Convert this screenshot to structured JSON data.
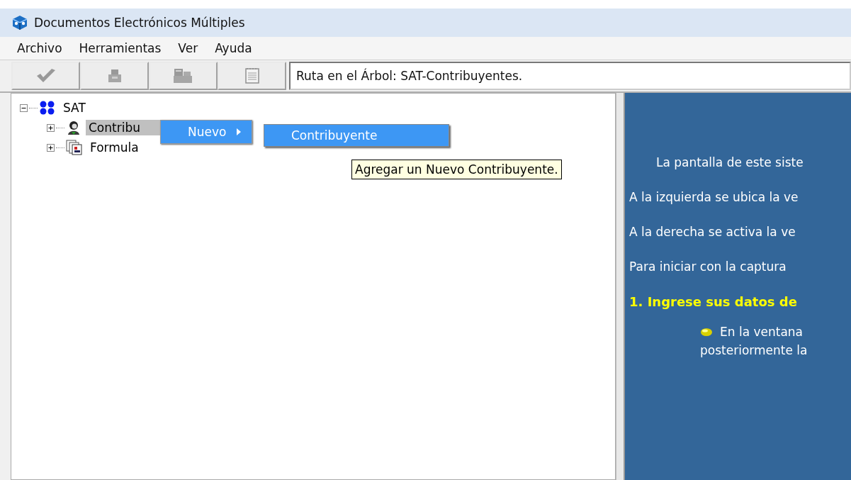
{
  "window": {
    "title": "Documentos Electrónicos Múltiples"
  },
  "menu_bar": [
    "Archivo",
    "Herramientas",
    "Ver",
    "Ayuda"
  ],
  "toolbar": {
    "buttons": [
      {
        "kind": "check",
        "disabled": true
      },
      {
        "kind": "printer",
        "disabled": true
      },
      {
        "kind": "fax",
        "disabled": true
      },
      {
        "kind": "notepad",
        "disabled": true
      }
    ],
    "path": "Ruta en el Árbol: SAT-Contribuyentes."
  },
  "tree": [
    {
      "label": "SAT",
      "kind": "root",
      "expanded": true,
      "selected": false,
      "children": [
        {
          "label": "Contribu",
          "kind": "person",
          "expanded": false,
          "selected": true
        },
        {
          "label": "Formula",
          "kind": "forms",
          "expanded": false,
          "selected": false
        }
      ]
    }
  ],
  "context_menu": {
    "items": [
      {
        "label": "Nuevo",
        "selected": true,
        "submenu": [
          {
            "label": "Contribuyente",
            "selected": true
          }
        ]
      }
    ]
  },
  "tooltip": "Agregar un Nuevo Contribuyente.",
  "help_panel": {
    "paragraphs": [
      {
        "kind": "indent",
        "text": "La pantalla de este siste"
      },
      {
        "kind": "plain",
        "text": "A la izquierda se ubica la ve"
      },
      {
        "kind": "plain",
        "text": "A la derecha se activa la ve"
      },
      {
        "kind": "plain",
        "text": "Para iniciar con la captura"
      },
      {
        "kind": "heading",
        "text": "1. Ingrese sus datos de"
      },
      {
        "kind": "bullet",
        "text": "En la ventana",
        "continuation": "posteriormente la"
      }
    ]
  }
}
